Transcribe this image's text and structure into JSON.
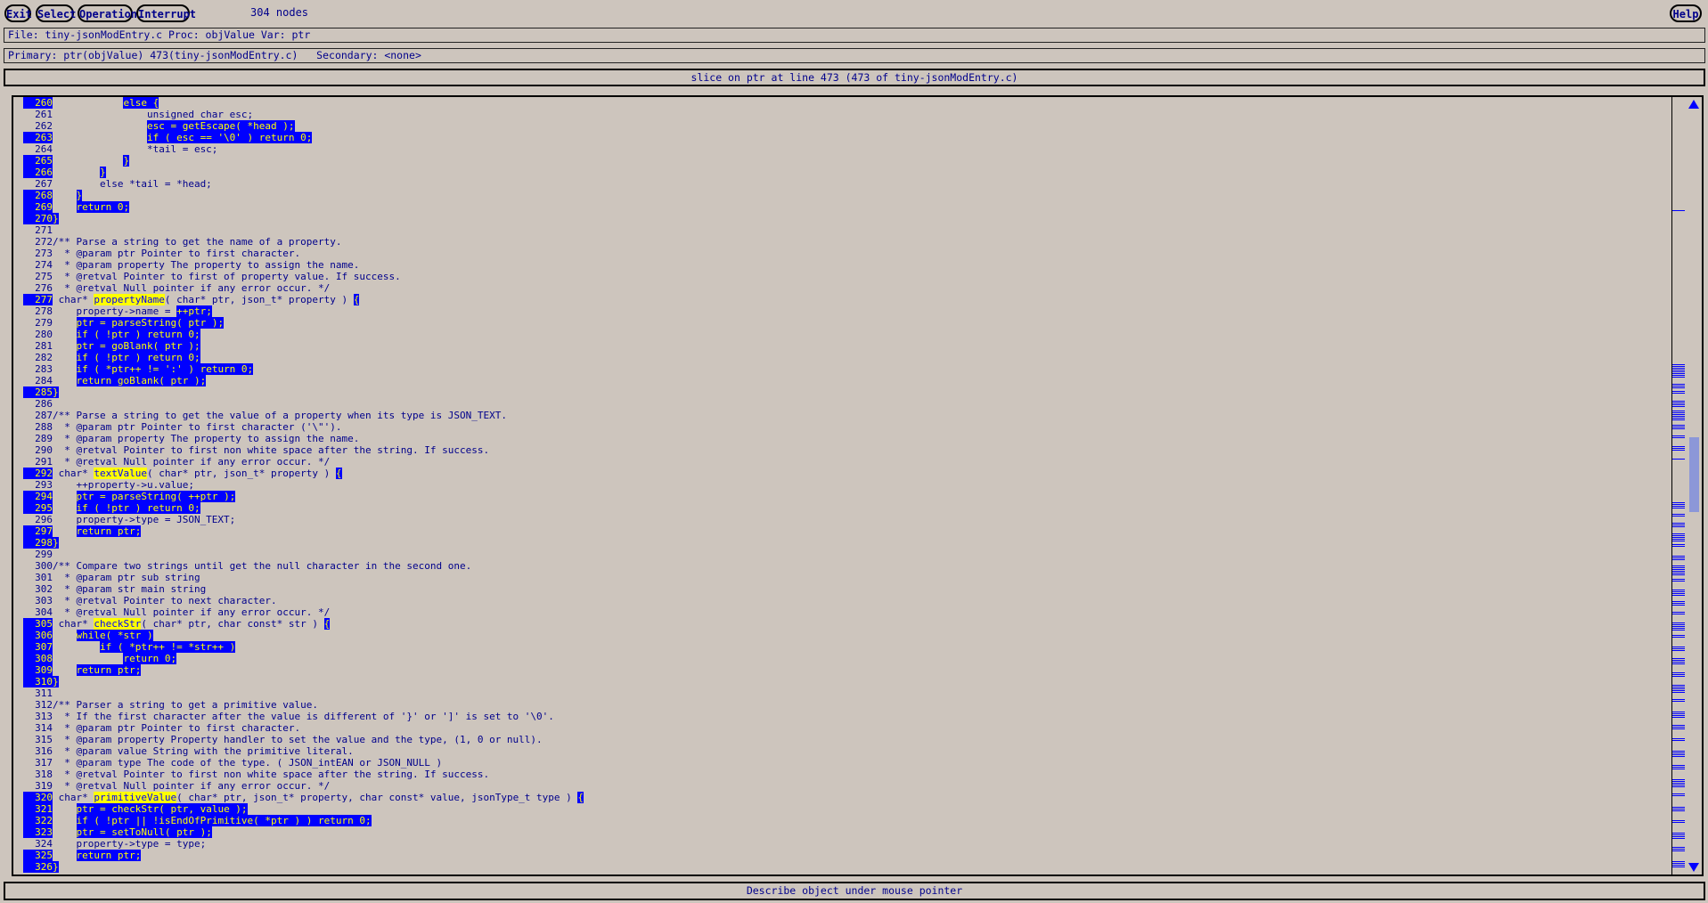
{
  "toolbar": {
    "exit": "Exit",
    "select": "Select",
    "operation": "Operation",
    "interrupt": "Interrupt",
    "nodes": "304 nodes",
    "help": "Help"
  },
  "file_info": "File: tiny-jsonModEntry.c Proc: objValue Var: ptr",
  "primary_info": "Primary: ptr(objValue) 473(tiny-jsonModEntry.c)   Secondary: <none>",
  "slice_title": "slice on ptr at line 473 (473 of tiny-jsonModEntry.c)",
  "status": "Describe object under mouse pointer",
  "code_lines": [
    {
      "n": "260",
      "hi": true,
      "segs": [
        [
          "            ",
          ""
        ],
        [
          "else {",
          "h"
        ]
      ]
    },
    {
      "n": "261",
      "hi": false,
      "segs": [
        [
          "                unsigned char esc;",
          ""
        ]
      ]
    },
    {
      "n": "262",
      "hi": false,
      "segs": [
        [
          "                ",
          ""
        ],
        [
          "esc = getEscape( *head );",
          "h"
        ]
      ]
    },
    {
      "n": "263",
      "hi": true,
      "segs": [
        [
          "                ",
          ""
        ],
        [
          "if ( esc == '\\0' ) return 0;",
          "h"
        ]
      ]
    },
    {
      "n": "264",
      "hi": false,
      "segs": [
        [
          "                *tail = esc;",
          ""
        ]
      ]
    },
    {
      "n": "265",
      "hi": true,
      "segs": [
        [
          "            ",
          ""
        ],
        [
          "}",
          "h"
        ]
      ]
    },
    {
      "n": "266",
      "hi": true,
      "segs": [
        [
          "        ",
          ""
        ],
        [
          "}",
          "h"
        ]
      ]
    },
    {
      "n": "267",
      "hi": false,
      "segs": [
        [
          "        else *tail = *head;",
          ""
        ]
      ]
    },
    {
      "n": "268",
      "hi": true,
      "segs": [
        [
          "    ",
          ""
        ],
        [
          "}",
          "h"
        ]
      ]
    },
    {
      "n": "269",
      "hi": true,
      "segs": [
        [
          "    ",
          ""
        ],
        [
          "return 0;",
          "h"
        ]
      ]
    },
    {
      "n": "270",
      "hi": true,
      "segs": [
        [
          "",
          ""
        ],
        [
          "}",
          "h"
        ]
      ]
    },
    {
      "n": "271",
      "hi": false,
      "segs": [
        [
          "",
          ""
        ]
      ]
    },
    {
      "n": "272",
      "hi": false,
      "segs": [
        [
          "/** Parse a string to get the name of a property.",
          ""
        ]
      ]
    },
    {
      "n": "273",
      "hi": false,
      "segs": [
        [
          "  * @param ptr Pointer to first character.",
          ""
        ]
      ]
    },
    {
      "n": "274",
      "hi": false,
      "segs": [
        [
          "  * @param property The property to assign the name.",
          ""
        ]
      ]
    },
    {
      "n": "275",
      "hi": false,
      "segs": [
        [
          "  * @retval Pointer to first of property value. If success.",
          ""
        ]
      ]
    },
    {
      "n": "276",
      "hi": false,
      "segs": [
        [
          "  * @retval Null pointer if any error occur. */",
          ""
        ]
      ]
    },
    {
      "n": "277",
      "hi": true,
      "segs": [
        [
          " char* ",
          ""
        ],
        [
          "propertyName",
          "fn"
        ],
        [
          "( char* ptr, json_t* property ) ",
          ""
        ],
        [
          "{",
          "h"
        ]
      ]
    },
    {
      "n": "278",
      "hi": false,
      "segs": [
        [
          "    property->name = ",
          ""
        ],
        [
          "++ptr;",
          "h"
        ]
      ]
    },
    {
      "n": "279",
      "hi": false,
      "segs": [
        [
          "    ",
          ""
        ],
        [
          "ptr = parseString( ptr );",
          "h"
        ]
      ]
    },
    {
      "n": "280",
      "hi": false,
      "segs": [
        [
          "    ",
          ""
        ],
        [
          "if ( !ptr ) return 0;",
          "h"
        ]
      ]
    },
    {
      "n": "281",
      "hi": false,
      "segs": [
        [
          "    ",
          ""
        ],
        [
          "ptr = goBlank( ptr );",
          "h"
        ]
      ]
    },
    {
      "n": "282",
      "hi": false,
      "segs": [
        [
          "    ",
          ""
        ],
        [
          "if ( !ptr ) return 0;",
          "h"
        ]
      ]
    },
    {
      "n": "283",
      "hi": false,
      "segs": [
        [
          "    ",
          ""
        ],
        [
          "if ( *ptr++ != ':' ) return 0;",
          "h"
        ]
      ]
    },
    {
      "n": "284",
      "hi": false,
      "segs": [
        [
          "    ",
          ""
        ],
        [
          "return goBlank( ptr );",
          "h"
        ]
      ]
    },
    {
      "n": "285",
      "hi": true,
      "segs": [
        [
          "",
          ""
        ],
        [
          "}",
          "h"
        ]
      ]
    },
    {
      "n": "286",
      "hi": false,
      "segs": [
        [
          "",
          ""
        ]
      ]
    },
    {
      "n": "287",
      "hi": false,
      "segs": [
        [
          "/** Parse a string to get the value of a property when its type is JSON_TEXT.",
          ""
        ]
      ]
    },
    {
      "n": "288",
      "hi": false,
      "segs": [
        [
          "  * @param ptr Pointer to first character ('\\\"').",
          ""
        ]
      ]
    },
    {
      "n": "289",
      "hi": false,
      "segs": [
        [
          "  * @param property The property to assign the name.",
          ""
        ]
      ]
    },
    {
      "n": "290",
      "hi": false,
      "segs": [
        [
          "  * @retval Pointer to first non white space after the string. If success.",
          ""
        ]
      ]
    },
    {
      "n": "291",
      "hi": false,
      "segs": [
        [
          "  * @retval Null pointer if any error occur. */",
          ""
        ]
      ]
    },
    {
      "n": "292",
      "hi": true,
      "segs": [
        [
          " char* ",
          ""
        ],
        [
          "textValue",
          "fn"
        ],
        [
          "( char* ptr, json_t* property ) ",
          ""
        ],
        [
          "{",
          "h"
        ]
      ]
    },
    {
      "n": "293",
      "hi": false,
      "segs": [
        [
          "    ++property->u.value;",
          ""
        ]
      ]
    },
    {
      "n": "294",
      "hi": true,
      "segs": [
        [
          "    ",
          ""
        ],
        [
          "ptr = parseString( ++ptr );",
          "h"
        ]
      ]
    },
    {
      "n": "295",
      "hi": true,
      "segs": [
        [
          "    ",
          ""
        ],
        [
          "if ( !ptr ) return 0;",
          "h"
        ]
      ]
    },
    {
      "n": "296",
      "hi": false,
      "segs": [
        [
          "    property->type = JSON_TEXT;",
          ""
        ]
      ]
    },
    {
      "n": "297",
      "hi": true,
      "segs": [
        [
          "    ",
          ""
        ],
        [
          "return ptr;",
          "h"
        ]
      ]
    },
    {
      "n": "298",
      "hi": true,
      "segs": [
        [
          "",
          ""
        ],
        [
          "}",
          "h"
        ]
      ]
    },
    {
      "n": "299",
      "hi": false,
      "segs": [
        [
          "",
          ""
        ]
      ]
    },
    {
      "n": "300",
      "hi": false,
      "segs": [
        [
          "/** Compare two strings until get the null character in the second one.",
          ""
        ]
      ]
    },
    {
      "n": "301",
      "hi": false,
      "segs": [
        [
          "  * @param ptr sub string",
          ""
        ]
      ]
    },
    {
      "n": "302",
      "hi": false,
      "segs": [
        [
          "  * @param str main string",
          ""
        ]
      ]
    },
    {
      "n": "303",
      "hi": false,
      "segs": [
        [
          "  * @retval Pointer to next character.",
          ""
        ]
      ]
    },
    {
      "n": "304",
      "hi": false,
      "segs": [
        [
          "  * @retval Null pointer if any error occur. */",
          ""
        ]
      ]
    },
    {
      "n": "305",
      "hi": true,
      "segs": [
        [
          " char* ",
          ""
        ],
        [
          "checkStr",
          "fn"
        ],
        [
          "( char* ptr, char const* str ) ",
          ""
        ],
        [
          "{",
          "h"
        ]
      ]
    },
    {
      "n": "306",
      "hi": true,
      "segs": [
        [
          "    ",
          ""
        ],
        [
          "while( *str )",
          "h"
        ]
      ]
    },
    {
      "n": "307",
      "hi": true,
      "segs": [
        [
          "        ",
          ""
        ],
        [
          "if ( *ptr++ != *str++ )",
          "h"
        ]
      ]
    },
    {
      "n": "308",
      "hi": true,
      "segs": [
        [
          "            ",
          ""
        ],
        [
          "return 0;",
          "h"
        ]
      ]
    },
    {
      "n": "309",
      "hi": true,
      "segs": [
        [
          "    ",
          ""
        ],
        [
          "return ptr;",
          "h"
        ]
      ]
    },
    {
      "n": "310",
      "hi": true,
      "segs": [
        [
          "",
          ""
        ],
        [
          "}",
          "h"
        ]
      ]
    },
    {
      "n": "311",
      "hi": false,
      "segs": [
        [
          "",
          ""
        ]
      ]
    },
    {
      "n": "312",
      "hi": false,
      "segs": [
        [
          "/** Parser a string to get a primitive value.",
          ""
        ]
      ]
    },
    {
      "n": "313",
      "hi": false,
      "segs": [
        [
          "  * If the first character after the value is different of '}' or ']' is set to '\\0'.",
          ""
        ]
      ]
    },
    {
      "n": "314",
      "hi": false,
      "segs": [
        [
          "  * @param ptr Pointer to first character.",
          ""
        ]
      ]
    },
    {
      "n": "315",
      "hi": false,
      "segs": [
        [
          "  * @param property Property handler to set the value and the type, (1, 0 or null).",
          ""
        ]
      ]
    },
    {
      "n": "316",
      "hi": false,
      "segs": [
        [
          "  * @param value String with the primitive literal.",
          ""
        ]
      ]
    },
    {
      "n": "317",
      "hi": false,
      "segs": [
        [
          "  * @param type The code of the type. ( JSON_intEAN or JSON_NULL )",
          ""
        ]
      ]
    },
    {
      "n": "318",
      "hi": false,
      "segs": [
        [
          "  * @retval Pointer to first non white space after the string. If success.",
          ""
        ]
      ]
    },
    {
      "n": "319",
      "hi": false,
      "segs": [
        [
          "  * @retval Null pointer if any error occur. */",
          ""
        ]
      ]
    },
    {
      "n": "320",
      "hi": true,
      "segs": [
        [
          " char* ",
          ""
        ],
        [
          "primitiveValue",
          "fn"
        ],
        [
          "( char* ptr, json_t* property, char const* value, jsonType_t type ) ",
          ""
        ],
        [
          "{",
          "h"
        ]
      ]
    },
    {
      "n": "321",
      "hi": true,
      "segs": [
        [
          "    ",
          ""
        ],
        [
          "ptr = checkStr( ptr, value );",
          "h"
        ]
      ]
    },
    {
      "n": "322",
      "hi": true,
      "segs": [
        [
          "    ",
          ""
        ],
        [
          "if ( !ptr || !isEndOfPrimitive( *ptr ) ) return 0;",
          "h"
        ]
      ]
    },
    {
      "n": "323",
      "hi": true,
      "segs": [
        [
          "    ",
          ""
        ],
        [
          "ptr = setToNull( ptr );",
          "h"
        ]
      ]
    },
    {
      "n": "324",
      "hi": false,
      "segs": [
        [
          "    property->type = type;",
          ""
        ]
      ]
    },
    {
      "n": "325",
      "hi": true,
      "segs": [
        [
          "    ",
          ""
        ],
        [
          "return ptr;",
          "h"
        ]
      ]
    },
    {
      "n": "326",
      "hi": true,
      "segs": [
        [
          "",
          ""
        ],
        [
          "}",
          "h"
        ]
      ]
    }
  ]
}
